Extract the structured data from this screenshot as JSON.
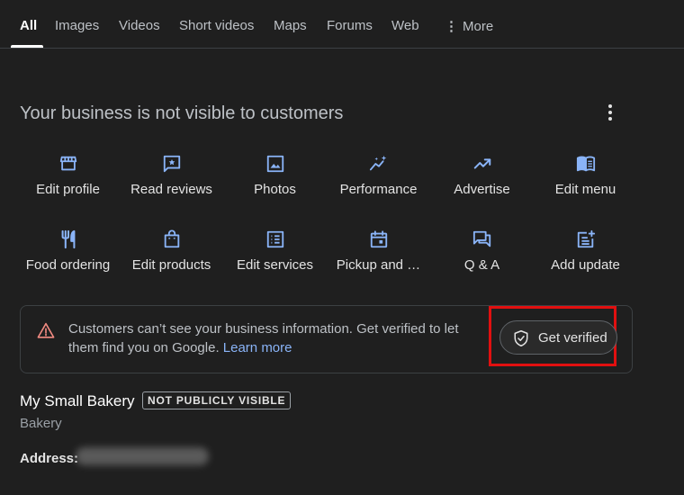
{
  "tabs": [
    {
      "label": "All",
      "active": true
    },
    {
      "label": "Images"
    },
    {
      "label": "Videos"
    },
    {
      "label": "Short videos"
    },
    {
      "label": "Maps"
    },
    {
      "label": "Forums"
    },
    {
      "label": "Web"
    },
    {
      "label": "More",
      "icon": "kebab-icon"
    }
  ],
  "panel": {
    "title": "Your business is not visible to customers",
    "menu_icon": "more-vert-icon"
  },
  "actions": [
    {
      "label": "Edit profile",
      "icon": "storefront-icon"
    },
    {
      "label": "Read reviews",
      "icon": "reviews-icon"
    },
    {
      "label": "Photos",
      "icon": "photo-icon"
    },
    {
      "label": "Performance",
      "icon": "performance-icon"
    },
    {
      "label": "Advertise",
      "icon": "trending-up-icon"
    },
    {
      "label": "Edit menu",
      "icon": "menu-book-icon"
    },
    {
      "label": "Food ordering",
      "icon": "restaurant-icon"
    },
    {
      "label": "Edit products",
      "icon": "shopping-bag-icon"
    },
    {
      "label": "Edit services",
      "icon": "list-icon"
    },
    {
      "label": "Pickup and …",
      "icon": "calendar-icon"
    },
    {
      "label": "Q & A",
      "icon": "question-answer-icon"
    },
    {
      "label": "Add update",
      "icon": "post-add-icon"
    }
  ],
  "notice": {
    "text": "Customers can’t see your business information. Get verified to let them find you on Google.",
    "link": "Learn more",
    "button": "Get verified",
    "icon": "warning-icon",
    "highlight_color": "#e11010"
  },
  "business": {
    "name": "My Small Bakery",
    "badge": "NOT PUBLICLY VISIBLE",
    "category": "Bakery",
    "address_label": "Address:"
  },
  "colors": {
    "background": "#1f1f1f",
    "icon_blue": "#8ab4f8",
    "warning_red": "#f28b82",
    "link": "#8ab4f8"
  }
}
